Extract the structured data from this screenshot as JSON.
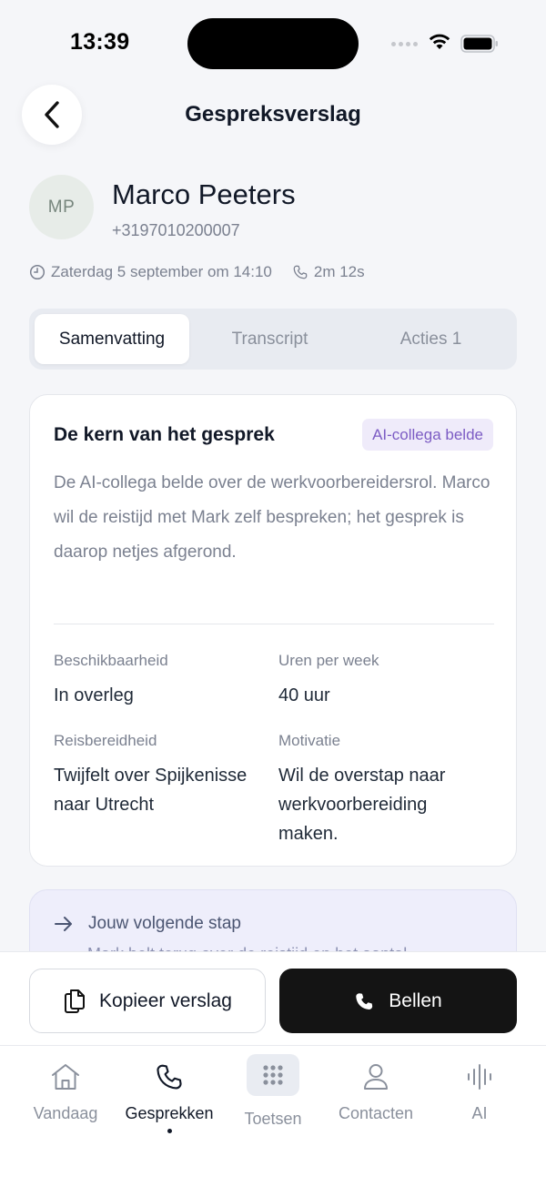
{
  "status_bar": {
    "time": "13:39"
  },
  "header": {
    "title": "Gespreksverslag"
  },
  "contact": {
    "initials": "MP",
    "name": "Marco Peeters",
    "phone": "+3197010200007",
    "date": "Zaterdag 5 september om 14:10",
    "duration": "2m 12s"
  },
  "tabs": [
    {
      "label": "Samenvatting",
      "active": true
    },
    {
      "label": "Transcript",
      "active": false
    },
    {
      "label": "Acties 1",
      "active": false
    }
  ],
  "summary": {
    "title": "De kern van het gesprek",
    "badge": "AI-collega belde",
    "text": "De AI-collega belde over de werkvoorbereidersrol. Marco wil de reistijd met Mark zelf bespreken; het gesprek is daarop netjes afgerond.",
    "fields": [
      {
        "label": "Beschikbaarheid",
        "value": "In overleg"
      },
      {
        "label": "Uren per week",
        "value": "40 uur"
      },
      {
        "label": "Reisbereidheid",
        "value": "Twijfelt over Spijkenisse naar Utrecht"
      },
      {
        "label": "Motivatie",
        "value": "Wil de overstap naar werkvoorbereiding maken."
      }
    ]
  },
  "next_step": {
    "title": "Jouw volgende stap",
    "text": "Mark belt terug over de reistijd en het aantal"
  },
  "actions": {
    "copy_label": "Kopieer verslag",
    "call_label": "Bellen"
  },
  "nav": [
    {
      "label": "Vandaag",
      "icon": "home-icon"
    },
    {
      "label": "Gesprekken",
      "icon": "phone-icon",
      "active": true
    },
    {
      "label": "Toetsen",
      "icon": "keypad-icon"
    },
    {
      "label": "Contacten",
      "icon": "user-icon"
    },
    {
      "label": "AI",
      "icon": "waveform-icon"
    }
  ],
  "colors": {
    "accent_purple": "#7c5cc4",
    "badge_bg": "#efebfa",
    "primary_button": "#141414",
    "next_step_bg": "#eeeefb"
  }
}
